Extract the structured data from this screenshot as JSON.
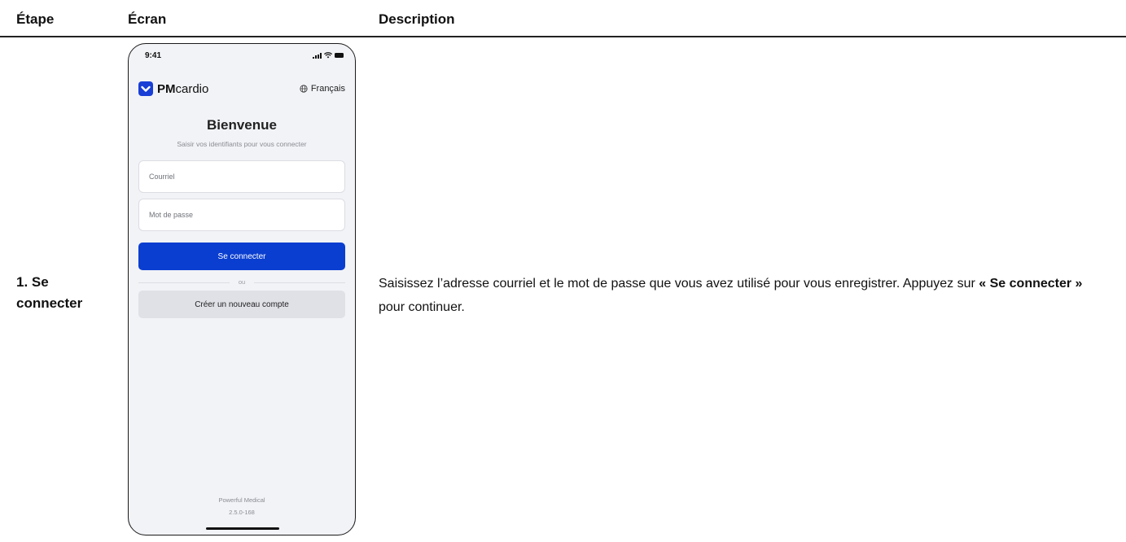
{
  "table": {
    "headers": {
      "step": "Étape",
      "screen": "Écran",
      "description": "Description"
    },
    "row": {
      "step": "1. Se connecter",
      "description_before": "Saisissez l’adresse courriel et le mot de passe que vous avez utilisé pour vous enregistrer. Appuyez sur",
      "description_bold": "« Se connecter »",
      "description_after": "pour continuer."
    }
  },
  "phone": {
    "status": {
      "time": "9:41"
    },
    "brand": {
      "bold": "PM",
      "regular": "cardio"
    },
    "language": "Français",
    "title": "Bienvenue",
    "subtitle": "Saisir vos identifiants pour vous connecter",
    "email_placeholder": "Courriel",
    "password_placeholder": "Mot de passe",
    "login_button": "Se connecter",
    "divider": "ou",
    "create_account_button": "Créer un nouveau compte",
    "footer_company": "Powerful Medical",
    "footer_version": "2.5.0-168"
  },
  "colors": {
    "primary": "#0a3ed0",
    "logo": "#1a3fd6",
    "background": "#f2f3f7"
  },
  "icons": [
    "signal-icon",
    "wifi-icon",
    "battery-icon",
    "pmcardio-logo-icon",
    "globe-icon"
  ]
}
